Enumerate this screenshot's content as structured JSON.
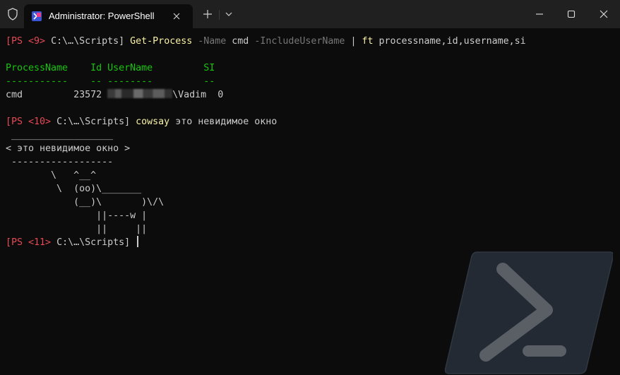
{
  "window": {
    "tab_title": "Administrator: PowerShell",
    "icons": {
      "shield": "shield-icon",
      "tab": "powershell-icon",
      "close_tab": "close-icon",
      "new_tab": "plus-icon",
      "dropdown": "chevron-down-icon",
      "minimize": "minimize-icon",
      "maximize": "maximize-icon",
      "close": "close-icon"
    }
  },
  "terminal": {
    "prompt1": {
      "ps": "[PS <9>",
      "path": "C:\\…\\Scripts]",
      "cmd": "Get-Process",
      "p1": "-Name",
      "a1": "cmd",
      "p2": "-IncludeUserName",
      "pipe": "|",
      "ft": "ft",
      "args": "processname,id,username,si"
    },
    "table": {
      "headers": [
        "ProcessName",
        "Id",
        "UserName",
        "SI"
      ],
      "underlines": [
        "-----------",
        "--",
        "--------",
        "--"
      ],
      "row": {
        "name": "cmd",
        "id": "23572",
        "user_suffix": "\\Vadim",
        "si": "0"
      }
    },
    "prompt2": {
      "ps": "[PS <10>",
      "path": "C:\\…\\Scripts]",
      "cmd": "cowsay",
      "args": "это невидимое окно"
    },
    "cowsay": [
      " __________________",
      "< это невидимое окно >",
      " ------------------",
      "        \\   ^__^",
      "         \\  (oo)\\_______",
      "            (__)\\       )\\/\\",
      "                ||----w |",
      "                ||     ||"
    ],
    "prompt3": {
      "ps": "[PS <11>",
      "path": "C:\\…\\Scripts]"
    }
  }
}
